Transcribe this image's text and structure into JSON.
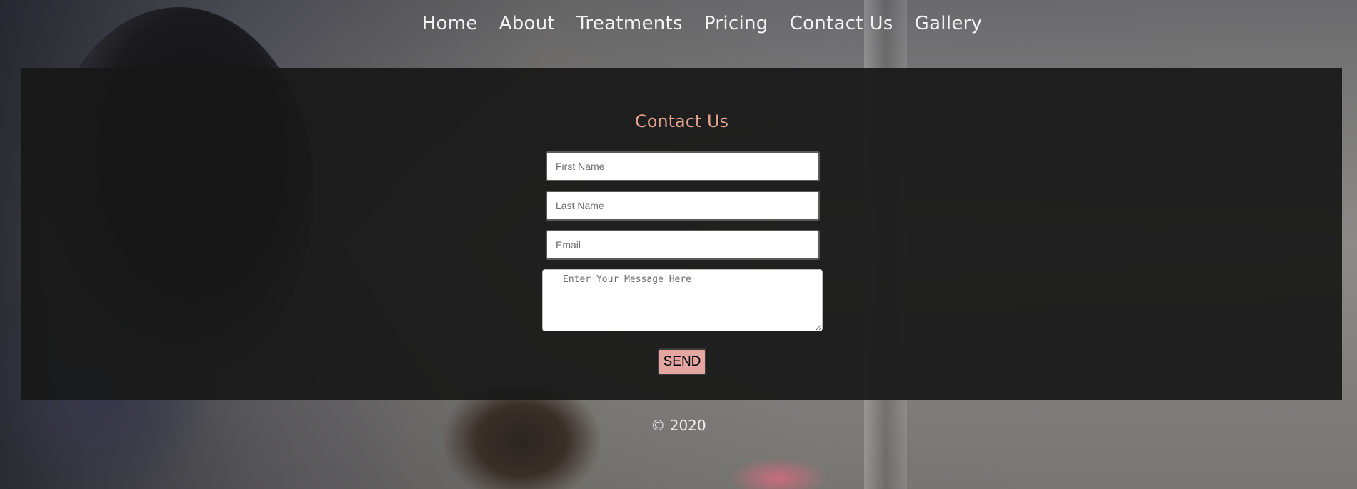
{
  "nav": {
    "items": [
      "Home",
      "About",
      "Treatments",
      "Pricing",
      "Contact Us",
      "Gallery"
    ]
  },
  "contact_form": {
    "title": "Contact Us",
    "first_name_placeholder": "First Name",
    "last_name_placeholder": "Last Name",
    "email_placeholder": "Email",
    "message_placeholder": "Enter Your Message Here",
    "send_label": "SEND"
  },
  "footer": {
    "copyright": "© 2020"
  },
  "colors": {
    "accent": "#e3a28f",
    "button": "#e3a6a0",
    "panel": "#181818"
  }
}
